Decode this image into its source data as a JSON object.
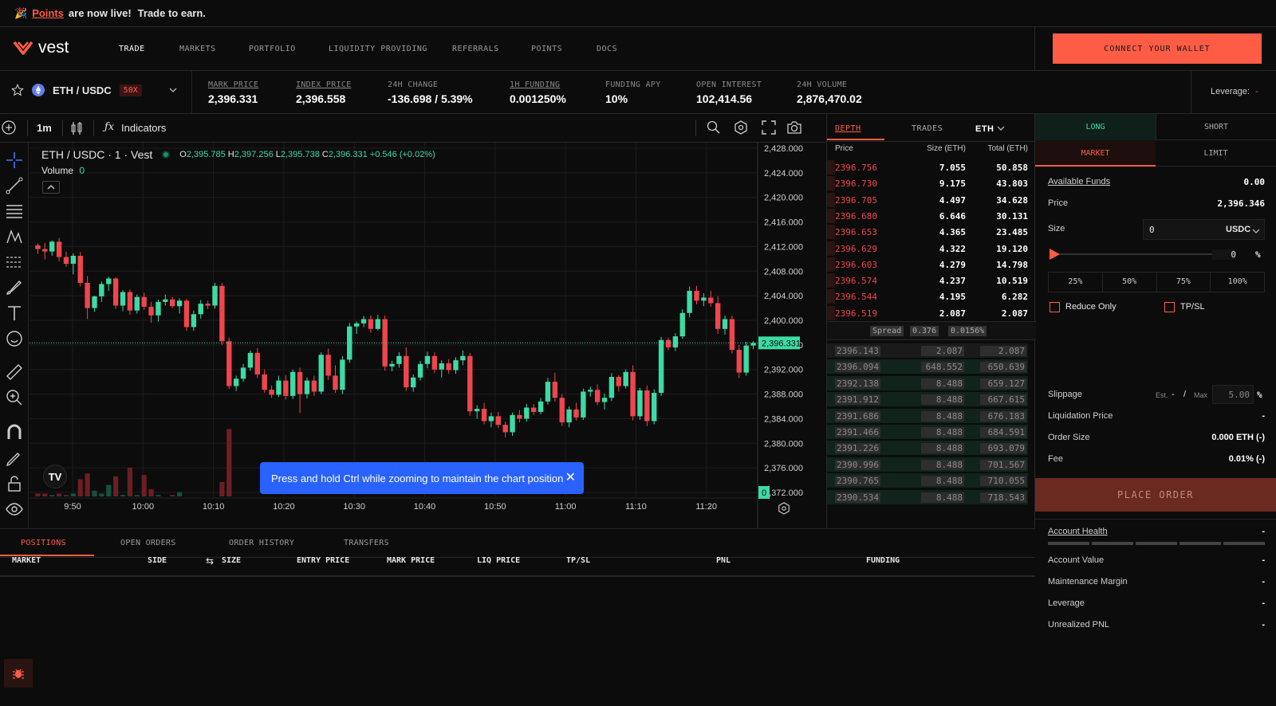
{
  "banner": {
    "emoji": "🎉",
    "link": "Points",
    "text1": "are now live!",
    "text2": "Trade to earn."
  },
  "nav": {
    "logo": "vest",
    "items": [
      "TRADE",
      "MARKETS",
      "PORTFOLIO",
      "LIQUIDITY PROVIDING",
      "REFERRALS",
      "POINTS",
      "DOCS"
    ],
    "connect": "CONNECT YOUR WALLET"
  },
  "ticker": {
    "pair": "ETH / USDC",
    "leverage_badge": "50X",
    "stats": [
      {
        "label": "MARK PRICE",
        "value": "2,396.331"
      },
      {
        "label": "INDEX PRICE",
        "value": "2,396.558"
      },
      {
        "label": "24H CHANGE",
        "value": "-136.698 / 5.39%"
      },
      {
        "label": "1H FUNDING",
        "value": "0.001250%"
      },
      {
        "label": "FUNDING APY",
        "value": "10%"
      },
      {
        "label": "OPEN INTEREST",
        "value": "102,414.56"
      },
      {
        "label": "24H VOLUME",
        "value": "2,876,470.02"
      }
    ],
    "leverage_label": "Leverage:",
    "leverage_value": "-"
  },
  "chart_toolbar": {
    "interval": "1m",
    "indicators": "Indicators"
  },
  "chart_legend": {
    "title": "ETH / USDC · 1 · Vest",
    "o": "2,395.785",
    "h": "2,397.256",
    "l": "2,395.738",
    "c": "2,396.331",
    "change": "+0.546 (+0.02%)",
    "volume_label": "Volume",
    "volume_value": "0"
  },
  "toast": "Press and hold Ctrl while zooming to maintain the chart position",
  "chart_data": {
    "type": "candlestick",
    "x_ticks": [
      "9:50",
      "10:00",
      "10:10",
      "10:20",
      "10:30",
      "10:40",
      "10:50",
      "11:00",
      "11:10",
      "11:20"
    ],
    "y_ticks": [
      "2,428.000",
      "2,424.000",
      "2,420.000",
      "2,416.000",
      "2,412.000",
      "2,408.000",
      "2,404.000",
      "2,400.000",
      "2,396.000",
      "2,392.000",
      "2,388.000",
      "2,384.000",
      "2,380.000",
      "2,376.000",
      "2,372.000"
    ],
    "ylim": [
      2372,
      2428
    ],
    "last_price": "2,396.331",
    "last_price_value": 2396.331,
    "volume_zero_label": "0",
    "candles": [
      [
        2412.2,
        2412.5,
        2410.8,
        2411.6
      ],
      [
        2411.6,
        2412.6,
        2409.9,
        2411.2
      ],
      [
        2411.2,
        2413.0,
        2410.5,
        2412.8
      ],
      [
        2412.8,
        2413.4,
        2409.6,
        2410.3
      ],
      [
        2410.3,
        2411.2,
        2408.7,
        2409.2
      ],
      [
        2409.2,
        2410.9,
        2407.5,
        2410.5
      ],
      [
        2410.5,
        2411.1,
        2405.5,
        2406.1
      ],
      [
        2406.1,
        2407.2,
        2400.2,
        2402.0
      ],
      [
        2402.0,
        2404.0,
        2401.4,
        2403.9
      ],
      [
        2403.9,
        2406.3,
        2403.0,
        2405.9
      ],
      [
        2405.9,
        2407.1,
        2404.8,
        2406.8
      ],
      [
        2406.8,
        2407.0,
        2401.9,
        2402.4
      ],
      [
        2402.4,
        2404.9,
        2401.5,
        2404.6
      ],
      [
        2404.6,
        2405.0,
        2400.9,
        2401.6
      ],
      [
        2401.6,
        2404.2,
        2401.1,
        2403.8
      ],
      [
        2403.8,
        2404.5,
        2401.7,
        2402.2
      ],
      [
        2402.2,
        2403.0,
        2399.6,
        2400.8
      ],
      [
        2400.8,
        2403.4,
        2399.8,
        2403.0
      ],
      [
        2403.0,
        2404.2,
        2402.4,
        2403.4
      ],
      [
        2403.4,
        2403.8,
        2402.0,
        2402.3
      ],
      [
        2402.3,
        2403.6,
        2401.1,
        2403.2
      ],
      [
        2403.2,
        2403.5,
        2398.3,
        2398.9
      ],
      [
        2398.9,
        2401.6,
        2398.3,
        2401.0
      ],
      [
        2401.0,
        2403.3,
        2400.3,
        2402.7
      ],
      [
        2402.7,
        2403.2,
        2401.8,
        2402.4
      ],
      [
        2402.4,
        2406.1,
        2401.9,
        2405.6
      ],
      [
        2405.6,
        2406.1,
        2396.0,
        2396.6
      ],
      [
        2396.6,
        2397.2,
        2388.8,
        2389.3
      ],
      [
        2389.3,
        2391.0,
        2388.5,
        2390.5
      ],
      [
        2390.5,
        2392.9,
        2390.0,
        2392.3
      ],
      [
        2392.3,
        2395.1,
        2391.8,
        2394.7
      ],
      [
        2394.7,
        2395.5,
        2390.6,
        2391.2
      ],
      [
        2391.2,
        2392.0,
        2388.2,
        2388.7
      ],
      [
        2388.7,
        2389.4,
        2387.4,
        2387.9
      ],
      [
        2387.9,
        2391.0,
        2387.5,
        2390.2
      ],
      [
        2390.2,
        2391.1,
        2387.1,
        2387.7
      ],
      [
        2387.7,
        2392.0,
        2387.2,
        2391.6
      ],
      [
        2391.6,
        2392.3,
        2384.9,
        2388.0
      ],
      [
        2388.0,
        2390.7,
        2387.3,
        2390.2
      ],
      [
        2390.2,
        2391.0,
        2387.7,
        2388.4
      ],
      [
        2388.4,
        2394.8,
        2388.0,
        2394.4
      ],
      [
        2394.4,
        2395.4,
        2390.3,
        2391.0
      ],
      [
        2391.0,
        2392.7,
        2388.2,
        2388.7
      ],
      [
        2388.7,
        2394.2,
        2388.0,
        2393.6
      ],
      [
        2393.6,
        2399.6,
        2393.1,
        2399.0
      ],
      [
        2399.0,
        2399.8,
        2397.8,
        2399.5
      ],
      [
        2399.5,
        2400.7,
        2398.9,
        2400.2
      ],
      [
        2400.2,
        2400.8,
        2398.0,
        2398.6
      ],
      [
        2398.6,
        2400.9,
        2398.4,
        2400.2
      ],
      [
        2400.2,
        2400.8,
        2391.8,
        2392.5
      ],
      [
        2392.5,
        2393.4,
        2391.7,
        2392.9
      ],
      [
        2392.9,
        2394.8,
        2392.3,
        2394.2
      ],
      [
        2394.2,
        2395.6,
        2388.5,
        2389.1
      ],
      [
        2389.1,
        2391.2,
        2388.4,
        2390.7
      ],
      [
        2390.7,
        2393.4,
        2390.2,
        2392.9
      ],
      [
        2392.9,
        2394.9,
        2392.2,
        2394.2
      ],
      [
        2394.2,
        2394.8,
        2391.4,
        2392.0
      ],
      [
        2392.0,
        2393.5,
        2390.7,
        2393.0
      ],
      [
        2393.0,
        2393.7,
        2391.3,
        2391.9
      ],
      [
        2391.9,
        2394.0,
        2391.3,
        2393.5
      ],
      [
        2393.5,
        2395.1,
        2392.7,
        2394.2
      ],
      [
        2394.2,
        2394.7,
        2384.5,
        2385.2
      ],
      [
        2385.2,
        2386.2,
        2384.0,
        2385.6
      ],
      [
        2385.6,
        2386.6,
        2383.1,
        2383.6
      ],
      [
        2383.6,
        2385.0,
        2382.6,
        2384.4
      ],
      [
        2384.4,
        2385.1,
        2382.5,
        2383.0
      ],
      [
        2383.0,
        2383.5,
        2381.0,
        2381.8
      ],
      [
        2381.8,
        2385.0,
        2381.2,
        2384.6
      ],
      [
        2384.6,
        2385.4,
        2383.4,
        2384.0
      ],
      [
        2384.0,
        2386.4,
        2383.5,
        2385.8
      ],
      [
        2385.8,
        2386.4,
        2384.6,
        2385.1
      ],
      [
        2385.1,
        2387.4,
        2384.7,
        2386.8
      ],
      [
        2386.8,
        2390.6,
        2386.3,
        2390.0
      ],
      [
        2390.0,
        2391.5,
        2386.8,
        2387.4
      ],
      [
        2387.4,
        2388.0,
        2382.8,
        2383.4
      ],
      [
        2383.4,
        2386.0,
        2382.6,
        2385.5
      ],
      [
        2385.5,
        2386.6,
        2383.7,
        2384.2
      ],
      [
        2384.2,
        2388.9,
        2383.8,
        2388.4
      ],
      [
        2388.4,
        2389.2,
        2387.6,
        2388.7
      ],
      [
        2388.7,
        2389.6,
        2386.2,
        2386.7
      ],
      [
        2386.7,
        2388.1,
        2385.5,
        2387.4
      ],
      [
        2387.4,
        2391.4,
        2386.9,
        2390.8
      ],
      [
        2390.8,
        2391.1,
        2388.4,
        2389.3
      ],
      [
        2389.3,
        2392.0,
        2388.9,
        2391.6
      ],
      [
        2391.6,
        2392.7,
        2383.7,
        2384.4
      ],
      [
        2384.4,
        2389.0,
        2383.8,
        2388.6
      ],
      [
        2388.6,
        2389.4,
        2382.8,
        2383.6
      ],
      [
        2383.6,
        2388.8,
        2383.1,
        2388.2
      ],
      [
        2388.2,
        2397.3,
        2387.7,
        2396.8
      ],
      [
        2396.8,
        2397.2,
        2395.1,
        2395.6
      ],
      [
        2395.6,
        2397.9,
        2395.0,
        2397.4
      ],
      [
        2397.4,
        2401.8,
        2397.0,
        2401.2
      ],
      [
        2401.2,
        2405.5,
        2400.5,
        2404.8
      ],
      [
        2404.8,
        2405.6,
        2402.6,
        2403.2
      ],
      [
        2403.2,
        2404.4,
        2402.3,
        2403.7
      ],
      [
        2403.7,
        2404.8,
        2402.2,
        2402.8
      ],
      [
        2402.8,
        2403.9,
        2397.8,
        2398.6
      ],
      [
        2398.6,
        2400.8,
        2397.7,
        2400.2
      ],
      [
        2400.2,
        2400.8,
        2394.6,
        2395.2
      ],
      [
        2395.2,
        2396.0,
        2390.6,
        2391.5
      ],
      [
        2391.5,
        2396.5,
        2391.0,
        2395.9
      ],
      [
        2395.9,
        2396.6,
        2395.3,
        2396.3
      ]
    ],
    "volume": [
      0.02,
      0.02,
      0.01,
      0.02,
      0.01,
      0.02,
      0.12,
      0.16,
      0.04,
      0.02,
      0.08,
      0.14,
      0.01,
      0.2,
      0.01,
      0.15,
      0.05,
      0.01,
      0.0,
      0.01,
      0.03,
      0.0,
      0.0,
      0.0,
      0.0,
      0.0,
      0.1,
      0.47,
      0.0,
      0.0,
      0.0,
      0.0,
      0.0,
      0.0,
      0.0,
      0.0,
      0.0,
      0.0,
      0.0,
      0.0,
      0.0,
      0.0,
      0.0,
      0.0,
      0.0,
      0.0,
      0.0,
      0.0,
      0.0,
      0.0,
      0.0,
      0.0,
      0.0,
      0.0,
      0.0,
      0.0,
      0.0,
      0.0,
      0.0,
      0.0,
      0.0,
      0.0,
      0.0,
      0.0,
      0.0,
      0.0,
      0.0,
      0.0,
      0.0,
      0.0,
      0.0,
      0.0,
      0.0,
      0.0,
      0.0,
      0.0,
      0.0,
      0.0,
      0.0,
      0.0,
      0.0,
      0.0,
      0.0,
      0.0,
      0.0,
      0.0,
      0.0,
      0.0,
      0.0,
      0.0,
      0.0,
      0.0,
      0.0,
      0.0,
      0.0,
      0.0,
      0.0,
      0.0,
      0.0,
      0.0,
      0.0,
      0.0
    ]
  },
  "orderbook": {
    "tabs": [
      "DEPTH",
      "TRADES"
    ],
    "asset": "ETH",
    "headers": [
      "Price",
      "Size (ETH)",
      "Total (ETH)"
    ],
    "asks": [
      [
        "2396.756",
        "7.055",
        "50.858"
      ],
      [
        "2396.730",
        "9.175",
        "43.803"
      ],
      [
        "2396.705",
        "4.497",
        "34.628"
      ],
      [
        "2396.680",
        "6.646",
        "30.131"
      ],
      [
        "2396.653",
        "4.365",
        "23.485"
      ],
      [
        "2396.629",
        "4.322",
        "19.120"
      ],
      [
        "2396.603",
        "4.279",
        "14.798"
      ],
      [
        "2396.574",
        "4.237",
        "10.519"
      ],
      [
        "2396.544",
        "4.195",
        "6.282"
      ],
      [
        "2396.519",
        "2.087",
        "2.087"
      ]
    ],
    "spread_label": "Spread",
    "spread_value": "0.376",
    "spread_pct": "0.0156%",
    "bids": [
      [
        "2396.143",
        "2.087",
        "2.087"
      ],
      [
        "2396.094",
        "648.552",
        "650.639"
      ],
      [
        "2392.138",
        "8.488",
        "659.127"
      ],
      [
        "2391.912",
        "8.488",
        "667.615"
      ],
      [
        "2391.686",
        "8.488",
        "676.183"
      ],
      [
        "2391.466",
        "8.488",
        "684.591"
      ],
      [
        "2391.226",
        "8.488",
        "693.079"
      ],
      [
        "2390.996",
        "8.488",
        "701.567"
      ],
      [
        "2390.765",
        "8.488",
        "710.055"
      ],
      [
        "2390.534",
        "8.488",
        "718.543"
      ]
    ]
  },
  "order_panel": {
    "side_tabs": [
      "LONG",
      "SHORT"
    ],
    "type_tabs": [
      "MARKET",
      "LIMIT"
    ],
    "available_funds_label": "Available Funds",
    "available_funds": "0.00",
    "price_label": "Price",
    "price": "2,396.346",
    "size_label": "Size",
    "size_value": "0",
    "size_unit": "USDC",
    "pct_value": "0",
    "pct_sign": "%",
    "pct_buttons": [
      "25%",
      "50%",
      "75%",
      "100%"
    ],
    "reduce_only": "Reduce Only",
    "tpsl": "TP/SL",
    "slippage_label": "Slippage",
    "est_label": "Est.",
    "est_value": "-",
    "slash": "/",
    "max_label": "Max",
    "max_value": "5.00",
    "max_unit": "%",
    "liq_label": "Liquidation Price",
    "liq_value": "-",
    "order_size_label": "Order Size",
    "order_size_value": "0.000 ETH (-)",
    "fee_label": "Fee",
    "fee_value": "0.01% (-)",
    "place_order": "PLACE ORDER",
    "account_health": "Account Health",
    "account_health_value": "-",
    "account_rows": [
      {
        "label": "Account Value",
        "value": "-"
      },
      {
        "label": "Maintenance Margin",
        "value": "-"
      },
      {
        "label": "Leverage",
        "value": "-"
      },
      {
        "label": "Unrealized PNL",
        "value": "-"
      }
    ]
  },
  "bottom": {
    "tabs": [
      "POSITIONS",
      "OPEN ORDERS",
      "ORDER HISTORY",
      "TRANSFERS"
    ],
    "columns": [
      "MARKET",
      "SIDE",
      "SIZE",
      "ENTRY PRICE",
      "MARK PRICE",
      "LIQ PRICE",
      "TP/SL",
      "PNL",
      "FUNDING"
    ]
  },
  "colors": {
    "accent": "#ff5c45",
    "up": "#3ddba4",
    "down": "#f0454d",
    "bg": "#0c0c0c"
  }
}
